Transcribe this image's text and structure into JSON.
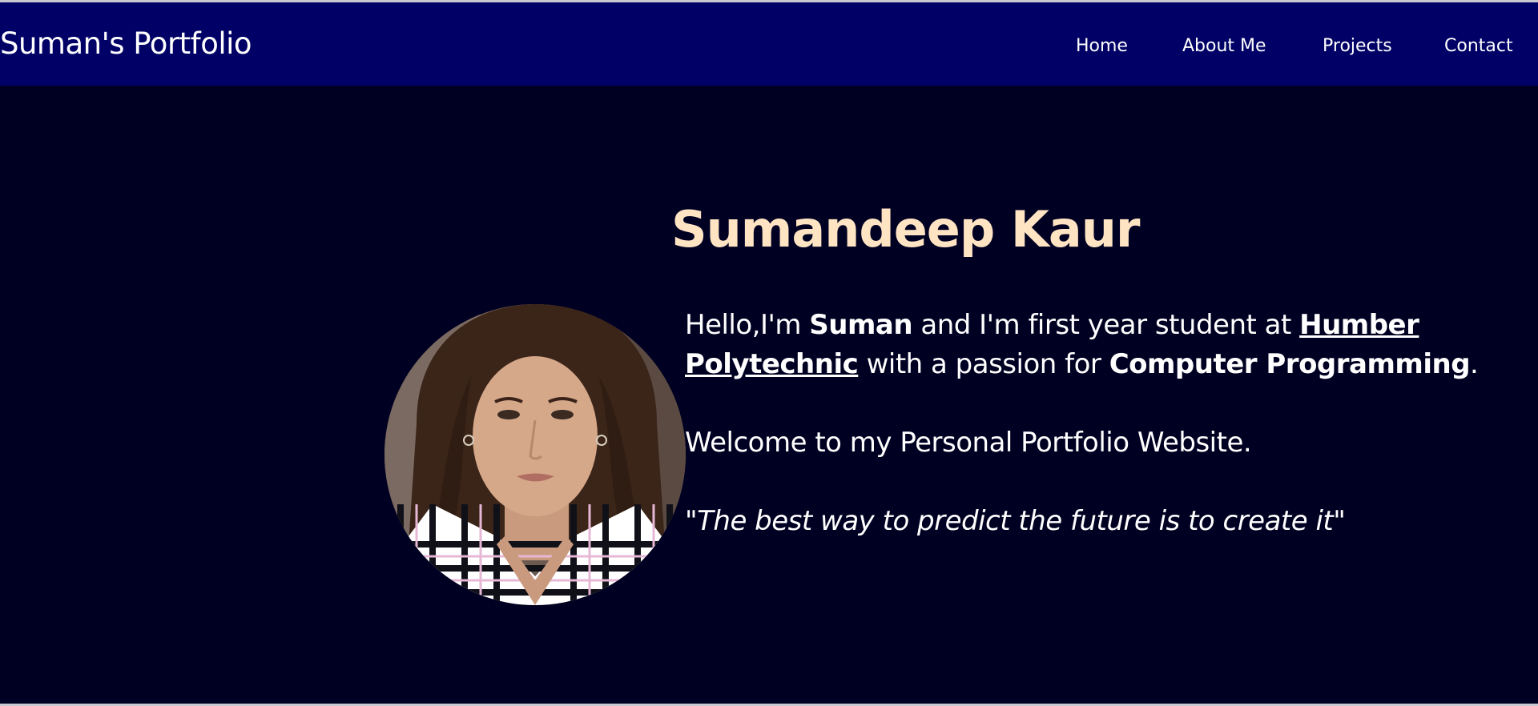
{
  "nav": {
    "brand": "Suman's Portfolio",
    "links": [
      "Home",
      "About Me",
      "Projects",
      "Contact"
    ]
  },
  "hero": {
    "name": "Sumandeep Kaur",
    "intro": {
      "greeting": "Hello,I'm ",
      "nickname": "Suman",
      "mid": " and I'm first year student at ",
      "school": "Humber Polytechnic",
      "passion_prefix": " with a passion for ",
      "passion": "Computer Programming",
      "end": "."
    },
    "welcome": "Welcome to my Personal Portfolio Website.",
    "quote_open": "\"",
    "quote_text": "The best way to predict the future is to create it",
    "quote_close": "\""
  },
  "colors": {
    "navbar": "#000066",
    "background": "#000022",
    "name": "#ffe4c4",
    "text": "#ffffff"
  },
  "icons": {
    "avatar": "profile-photo"
  }
}
